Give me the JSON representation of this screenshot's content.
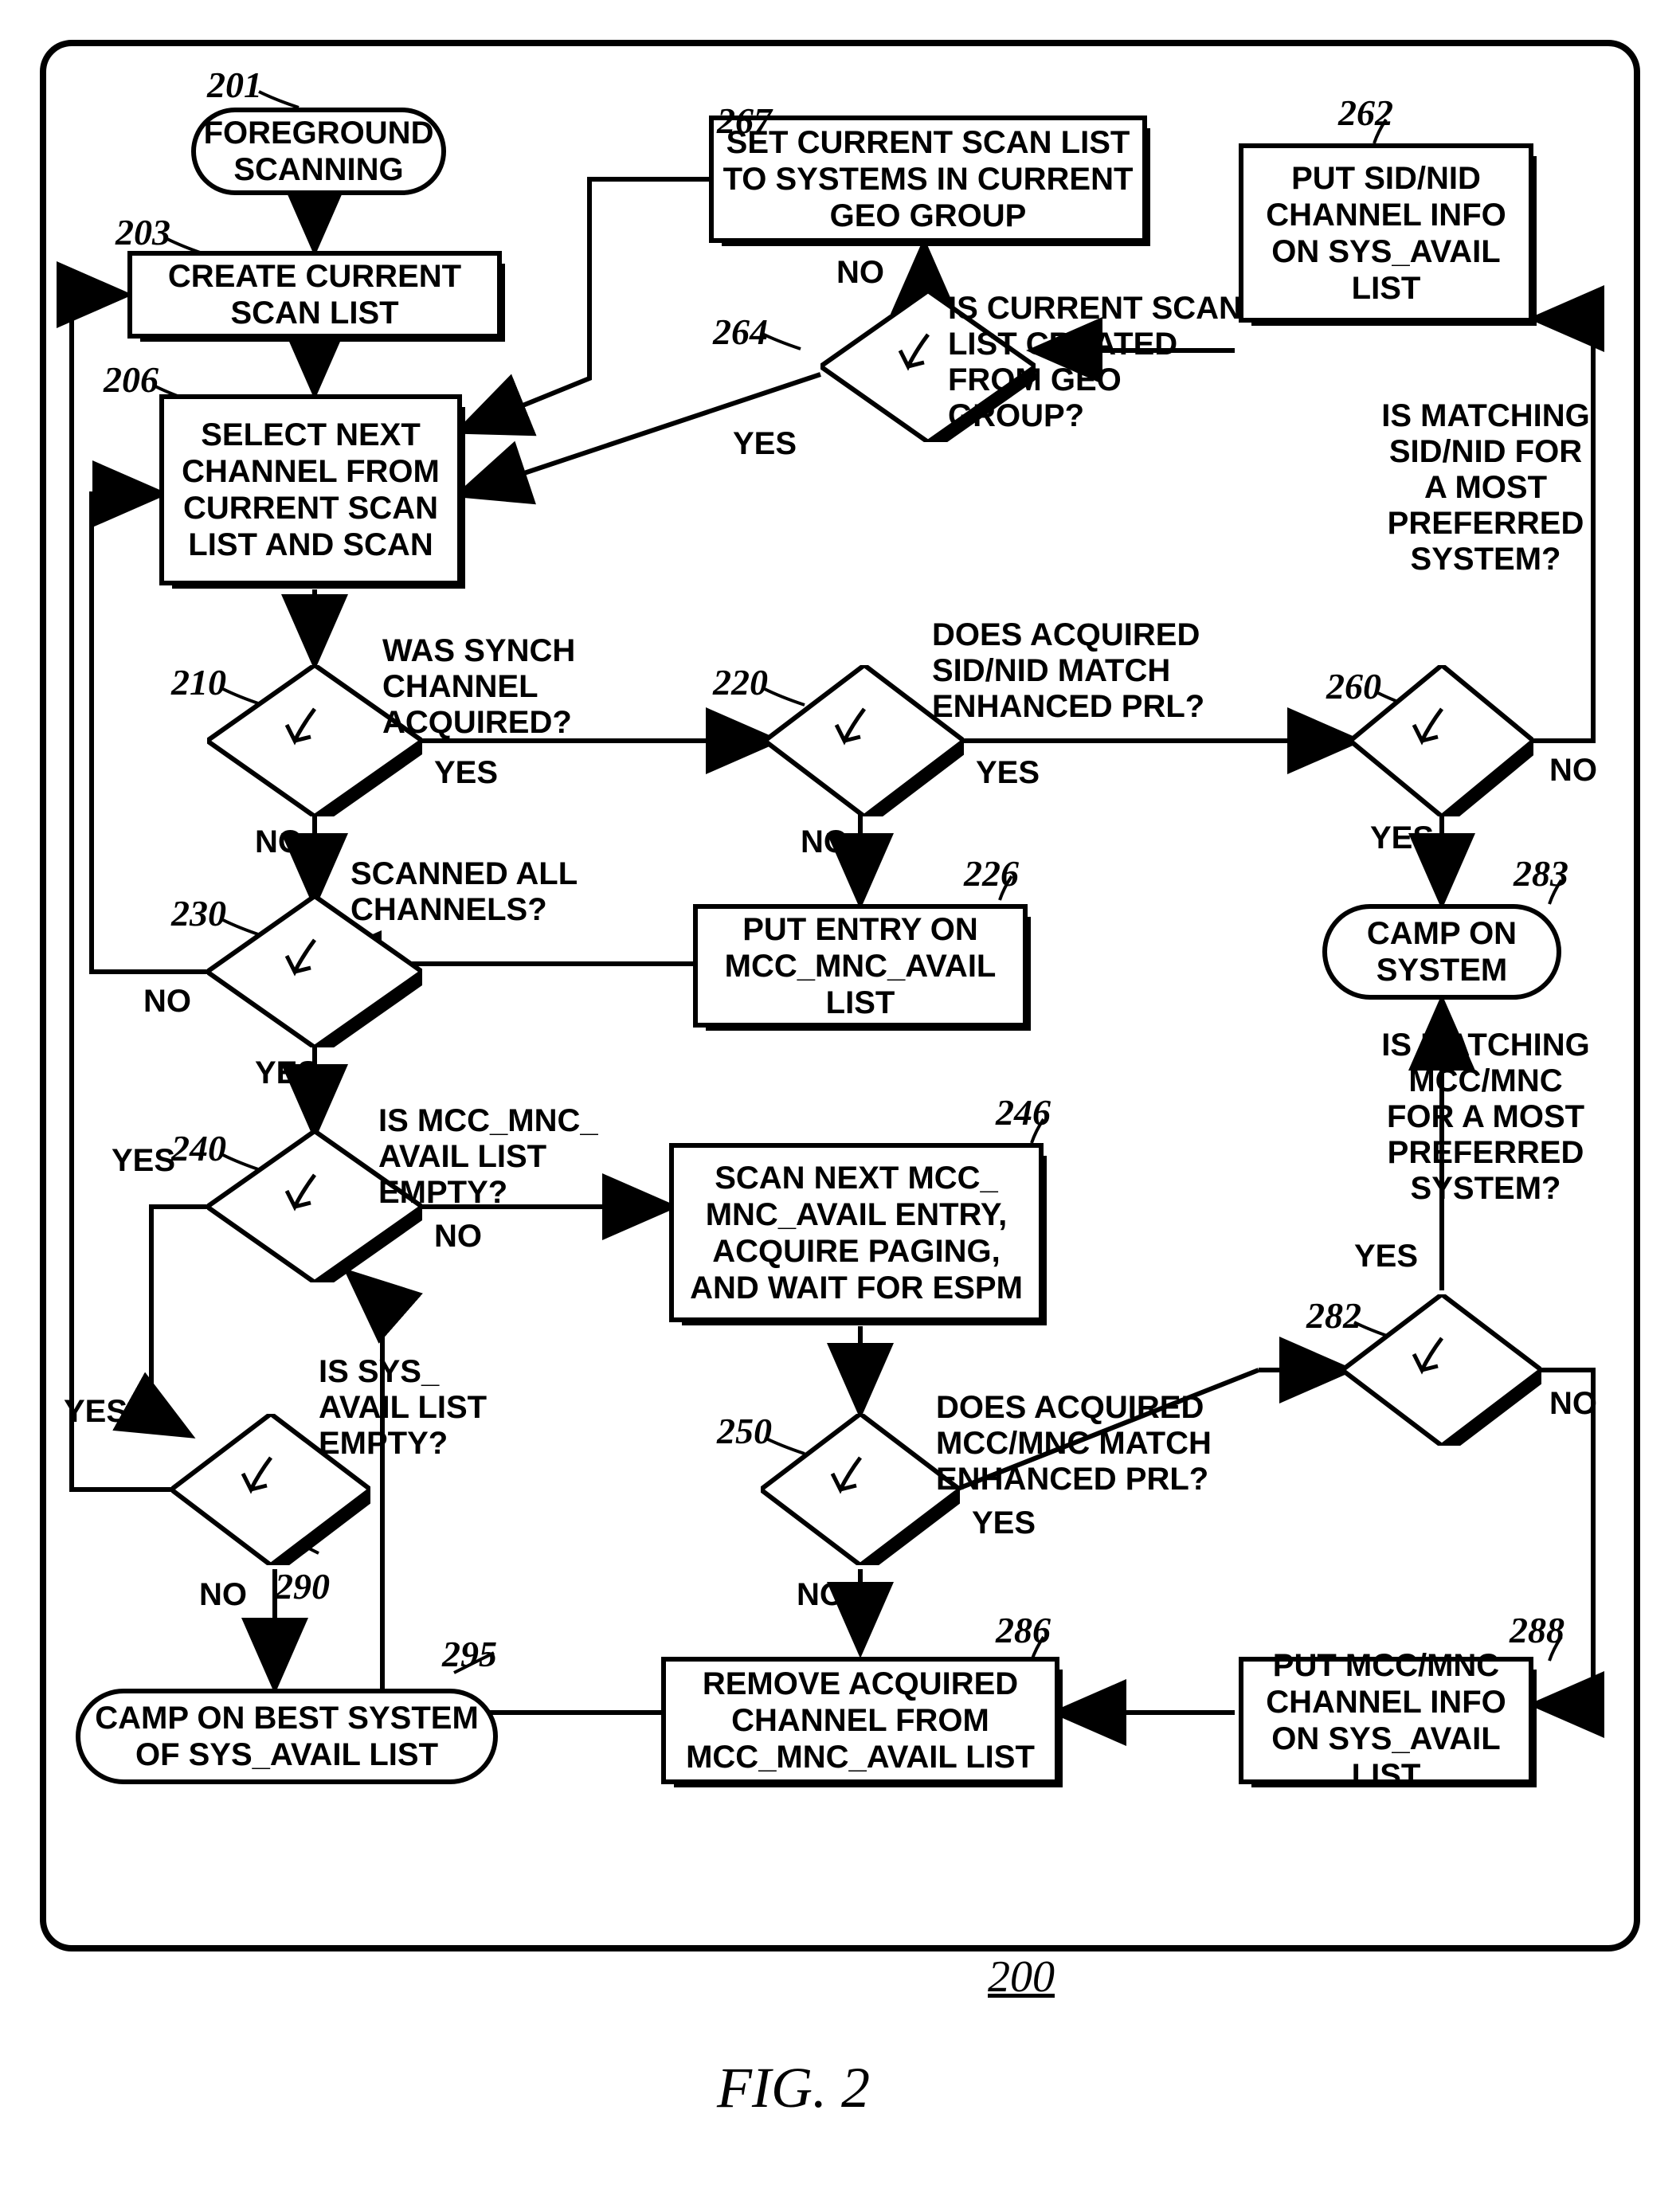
{
  "fig": {
    "number": "200",
    "caption": "FIG. 2"
  },
  "nodes": {
    "n201": {
      "num": "201",
      "text": "FOREGROUND SCANNING"
    },
    "n203": {
      "num": "203",
      "text": "CREATE CURRENT SCAN LIST"
    },
    "n206": {
      "num": "206",
      "text": "SELECT NEXT CHANNEL FROM CURRENT SCAN LIST AND SCAN"
    },
    "n210": {
      "num": "210",
      "q": "WAS SYNCH CHANNEL ACQUIRED?"
    },
    "n220": {
      "num": "220",
      "q": "DOES ACQUIRED SID/NID MATCH ENHANCED PRL?"
    },
    "n226": {
      "num": "226",
      "text": "PUT ENTRY ON MCC_MNC_AVAIL LIST"
    },
    "n230": {
      "num": "230",
      "q": "SCANNED ALL CHANNELS?"
    },
    "n240": {
      "num": "240",
      "q": "IS MCC_MNC_ AVAIL LIST EMPTY?"
    },
    "n246": {
      "num": "246",
      "text": "SCAN NEXT MCC_ MNC_AVAIL ENTRY, ACQUIRE PAGING, AND WAIT FOR ESPM"
    },
    "n250": {
      "num": "250",
      "q": "DOES ACQUIRED MCC/MNC MATCH ENHANCED PRL?"
    },
    "n260": {
      "num": "260",
      "q": "IS MATCHING SID/NID FOR A MOST PREFERRED SYSTEM?"
    },
    "n262": {
      "num": "262",
      "text": "PUT SID/NID CHANNEL INFO ON SYS_AVAIL LIST"
    },
    "n264": {
      "num": "264",
      "q": "IS CURRENT SCAN LIST CREATED FROM GEO GROUP?"
    },
    "n267": {
      "num": "267",
      "text": "SET CURRENT SCAN LIST TO SYSTEMS IN CURRENT GEO GROUP"
    },
    "n282": {
      "num": "282",
      "q": "IS MATCHING MCC/MNC FOR A MOST PREFERRED SYSTEM?"
    },
    "n283": {
      "num": "283",
      "text": "CAMP ON SYSTEM"
    },
    "n286": {
      "num": "286",
      "text": "REMOVE ACQUIRED CHANNEL FROM MCC_MNC_AVAIL LIST"
    },
    "n288": {
      "num": "288",
      "text": "PUT MCC/MNC CHANNEL INFO ON SYS_AVAIL LIST"
    },
    "n290": {
      "num": "290",
      "q": "IS SYS_ AVAIL LIST EMPTY?"
    },
    "n295": {
      "num": "295",
      "text": "CAMP ON BEST SYSTEM OF SYS_AVAIL LIST"
    }
  },
  "labels": {
    "yes": "YES",
    "no": "NO"
  }
}
